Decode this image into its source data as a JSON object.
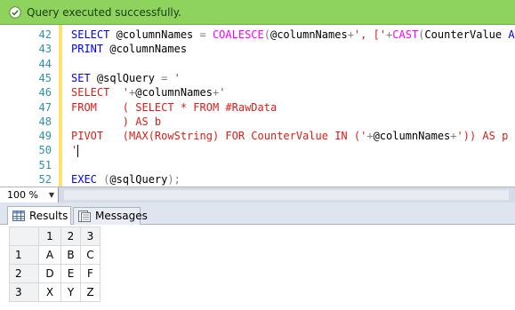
{
  "status": {
    "message": "Query executed successfully.",
    "color": "#8ed35e"
  },
  "editor": {
    "lines": [
      {
        "num": "42",
        "tokens": [
          [
            "kw",
            "SELECT "
          ],
          [
            "var",
            "@columnNames "
          ],
          [
            "op",
            "= "
          ],
          [
            "fn",
            "COALESCE"
          ],
          [
            "op",
            "("
          ],
          [
            "var",
            "@columnNames"
          ],
          [
            "op",
            "+"
          ],
          [
            "str",
            "', ['"
          ],
          [
            "op",
            "+"
          ],
          [
            "fn",
            "CAST"
          ],
          [
            "op",
            "("
          ],
          [
            "var",
            "CounterValue "
          ],
          [
            "kw",
            "AS V"
          ]
        ]
      },
      {
        "num": "43",
        "tokens": [
          [
            "kw",
            "PRINT "
          ],
          [
            "var",
            "@columnNames"
          ]
        ]
      },
      {
        "num": "44",
        "tokens": []
      },
      {
        "num": "45",
        "tokens": [
          [
            "kw",
            "SET "
          ],
          [
            "var",
            "@sqlQuery "
          ],
          [
            "op",
            "= "
          ],
          [
            "str",
            "'"
          ]
        ]
      },
      {
        "num": "46",
        "tokens": [
          [
            "str",
            "SELECT  '"
          ],
          [
            "op",
            "+"
          ],
          [
            "var",
            "@columnNames"
          ],
          [
            "op",
            "+"
          ],
          [
            "str",
            "'"
          ]
        ]
      },
      {
        "num": "47",
        "tokens": [
          [
            "str",
            "FROM    ( SELECT * FROM #RawData"
          ]
        ]
      },
      {
        "num": "48",
        "tokens": [
          [
            "str",
            "        ) AS b"
          ]
        ]
      },
      {
        "num": "49",
        "tokens": [
          [
            "str",
            "PIVOT   (MAX(RowString) FOR CounterValue IN ('"
          ],
          [
            "op",
            "+"
          ],
          [
            "var",
            "@columnNames"
          ],
          [
            "op",
            "+"
          ],
          [
            "str",
            "')) AS p"
          ]
        ]
      },
      {
        "num": "50",
        "tokens": [
          [
            "str",
            "'"
          ]
        ]
      },
      {
        "num": "51",
        "tokens": []
      },
      {
        "num": "52",
        "tokens": [
          [
            "kw",
            "EXEC "
          ],
          [
            "op",
            "("
          ],
          [
            "var",
            "@sqlQuery"
          ],
          [
            "op",
            ");"
          ]
        ]
      }
    ]
  },
  "zoom": {
    "value": "100 %"
  },
  "tabs": {
    "results_label": "Results",
    "messages_label": "Messages"
  },
  "grid": {
    "headers": [
      "",
      "1",
      "2",
      "3"
    ],
    "rows": [
      [
        "1",
        "A",
        "B",
        "C"
      ],
      [
        "2",
        "D",
        "E",
        "F"
      ],
      [
        "3",
        "X",
        "Y",
        "Z"
      ]
    ]
  }
}
